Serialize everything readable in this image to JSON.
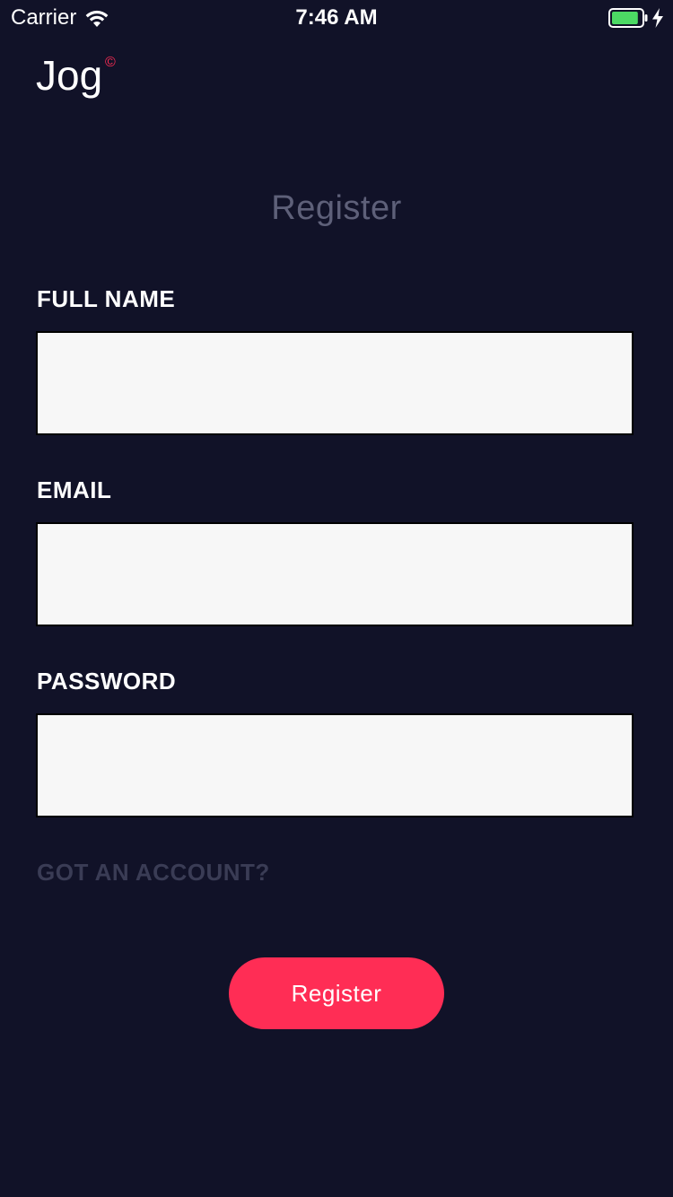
{
  "status_bar": {
    "carrier": "Carrier",
    "time": "7:46 AM",
    "battery_level": 0.9,
    "battery_color": "#4cd964",
    "wifi_icon": "wifi-icon",
    "charging_icon": "bolt-icon"
  },
  "logo": {
    "text": "Jog",
    "mark": "©",
    "mark_color": "#ff2d55"
  },
  "title": "Register",
  "form": {
    "full_name": {
      "label": "FULL NAME",
      "value": "",
      "placeholder": ""
    },
    "email": {
      "label": "EMAIL",
      "value": "",
      "placeholder": ""
    },
    "password": {
      "label": "PASSWORD",
      "value": "",
      "placeholder": ""
    }
  },
  "account_link": "GOT AN ACCOUNT?",
  "register_button": {
    "label": "Register",
    "color": "#ff2d55"
  },
  "colors": {
    "background": "#111228",
    "input_background": "#f7f7f7",
    "title": "#5e6079",
    "muted_link": "#3a3c55"
  }
}
